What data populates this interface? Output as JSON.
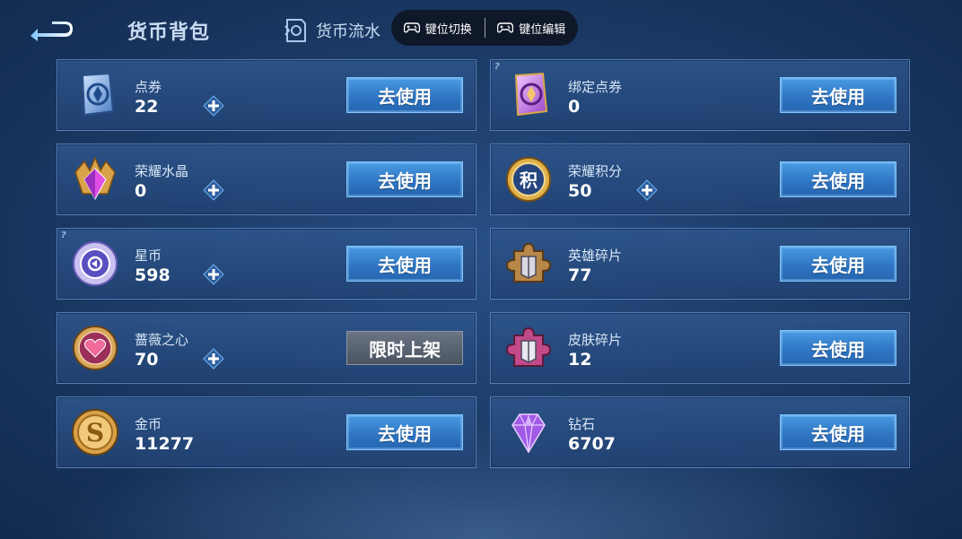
{
  "header": {
    "title": "货币背包",
    "flow_tab": "货币流水",
    "key_switch": "键位切换",
    "key_edit": "键位编辑"
  },
  "cards": [
    {
      "name": "点券",
      "amount": "22",
      "action": "去使用",
      "icon": "coupon-icon",
      "plus": true
    },
    {
      "name": "绑定点券",
      "amount": "0",
      "action": "去使用",
      "icon": "bound-coupon-icon",
      "plus": false
    },
    {
      "name": "荣耀水晶",
      "amount": "0",
      "action": "去使用",
      "icon": "glory-crystal-icon",
      "plus": true
    },
    {
      "name": "荣耀积分",
      "amount": "50",
      "action": "去使用",
      "icon": "glory-points-icon",
      "plus": true,
      "icon_text": "积"
    },
    {
      "name": "星币",
      "amount": "598",
      "action": "去使用",
      "icon": "star-coin-icon",
      "plus": true
    },
    {
      "name": "英雄碎片",
      "amount": "77",
      "action": "去使用",
      "icon": "hero-fragment-icon",
      "plus": false
    },
    {
      "name": "蔷薇之心",
      "amount": "70",
      "action": "限时上架",
      "icon": "rose-heart-icon",
      "plus": true
    },
    {
      "name": "皮肤碎片",
      "amount": "12",
      "action": "去使用",
      "icon": "skin-fragment-icon",
      "plus": false
    },
    {
      "name": "金币",
      "amount": "11277",
      "action": "去使用",
      "icon": "gold-coin-icon",
      "plus": false,
      "icon_text": "S"
    },
    {
      "name": "钻石",
      "amount": "6707",
      "action": "去使用",
      "icon": "diamond-icon",
      "plus": false
    }
  ],
  "colors": {
    "accent": "#3b86d4",
    "background": "#1b3a66"
  }
}
